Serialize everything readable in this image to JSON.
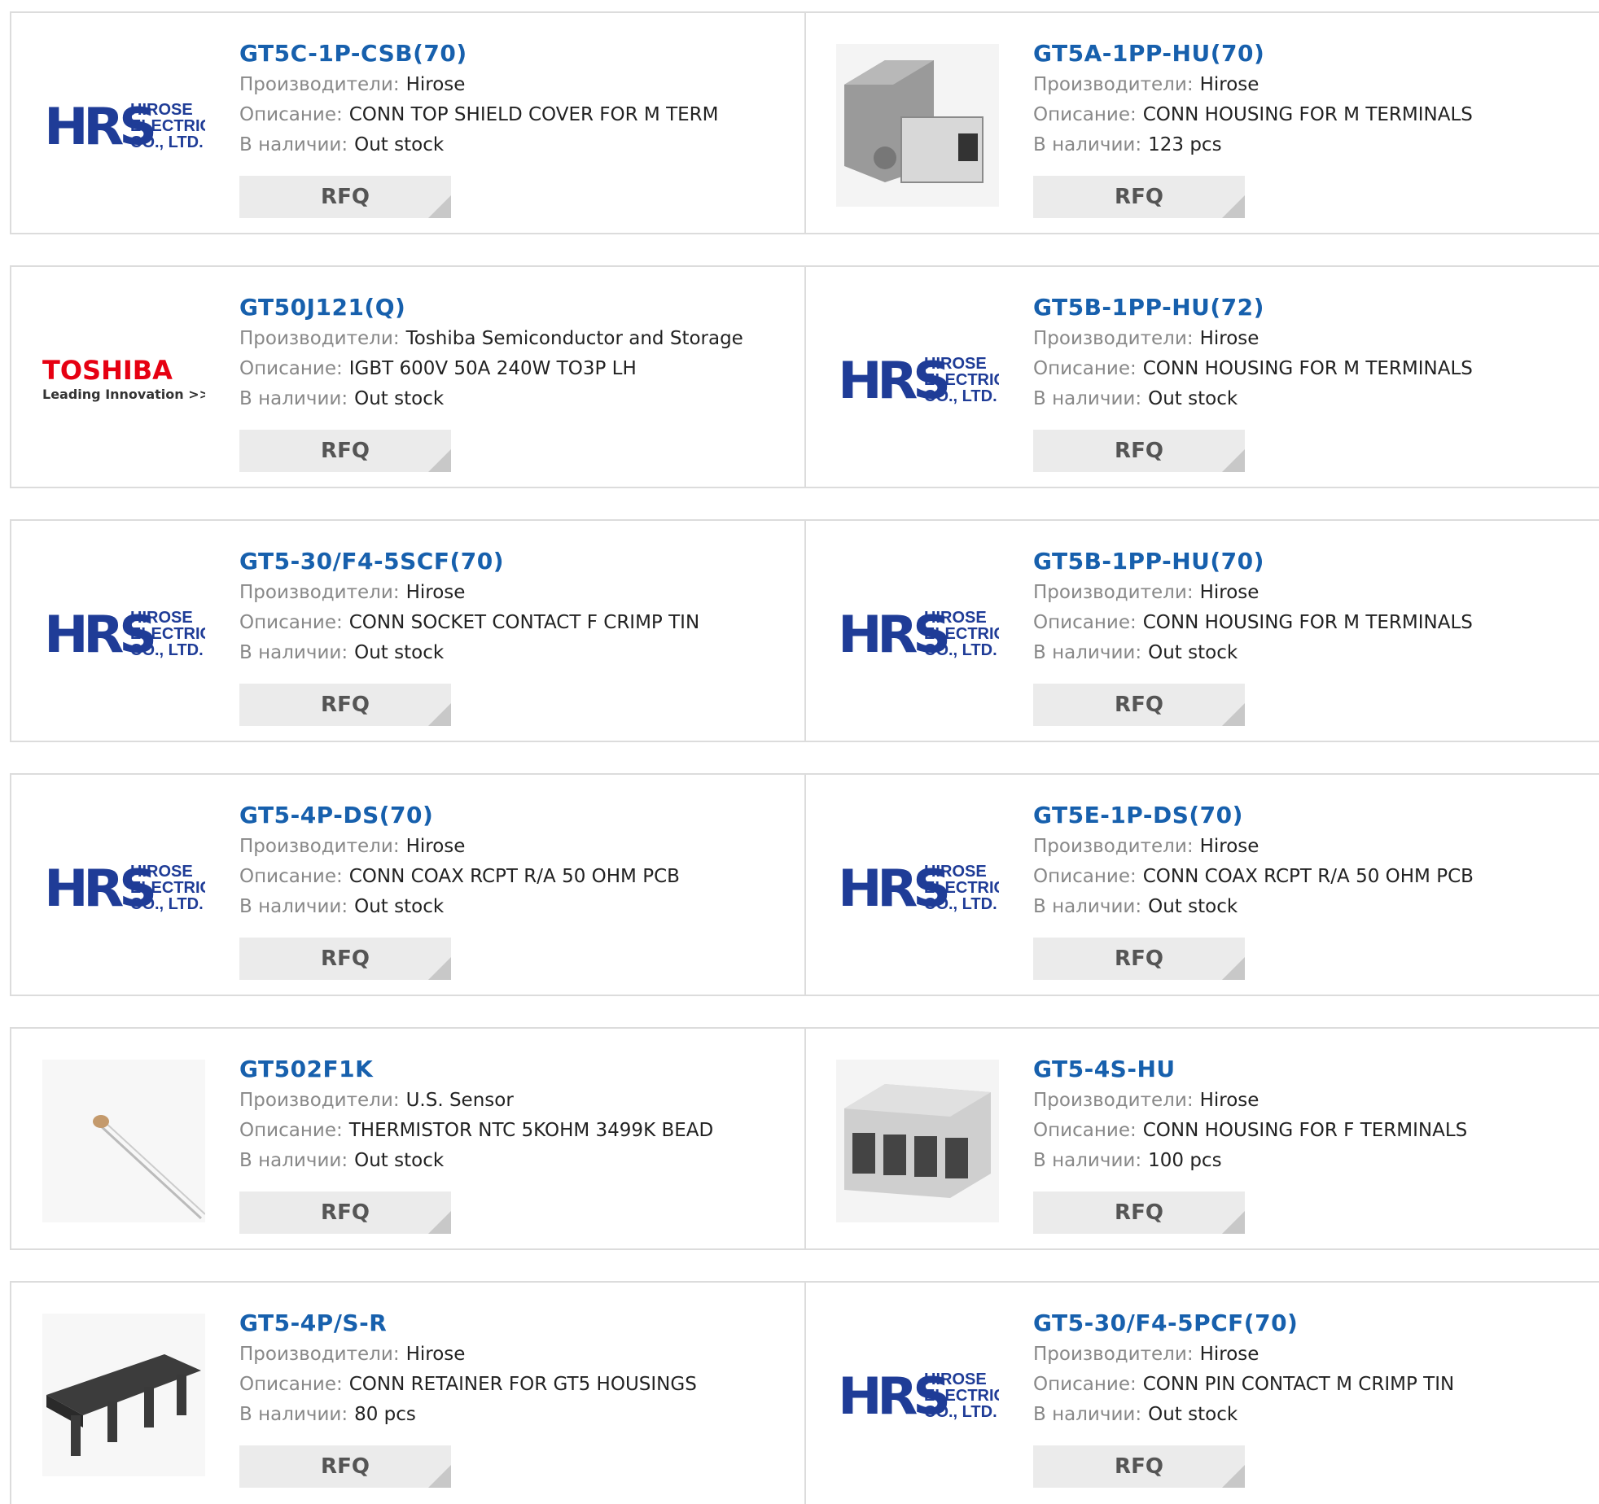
{
  "labels": {
    "manufacturer": "Производители:",
    "description": "Описание:",
    "stock": "В наличии:",
    "rfq": "RFQ"
  },
  "logos": {
    "hrs_mark": "HRS",
    "hrs_text1": "HIROSE",
    "hrs_text2": "ELECTRIC",
    "hrs_text3": "CO., LTD.",
    "toshiba_mark": "TOSHIBA",
    "toshiba_tagline": "Leading Innovation >>>"
  },
  "colors": {
    "link": "#1760ad",
    "hrs_blue": "#1f3c97",
    "toshiba_red": "#e60012"
  },
  "products": [
    {
      "pn": "GT5C-1P-CSB(70)",
      "mfr": "Hirose",
      "desc": "CONN TOP SHIELD COVER FOR M TERM",
      "stock": "Out stock",
      "image": "hrs-logo"
    },
    {
      "pn": "GT5A-1PP-HU(70)",
      "mfr": "Hirose",
      "desc": "CONN HOUSING FOR M TERMINALS",
      "stock": "123 pcs",
      "image": "housing-photo"
    },
    {
      "pn": "GT50J121(Q)",
      "mfr": "Toshiba Semiconductor and Storage",
      "desc": "IGBT 600V 50A 240W TO3P LH",
      "stock": "Out stock",
      "image": "toshiba-logo"
    },
    {
      "pn": "GT5B-1PP-HU(72)",
      "mfr": "Hirose",
      "desc": "CONN HOUSING FOR M TERMINALS",
      "stock": "Out stock",
      "image": "hrs-logo"
    },
    {
      "pn": "GT5-30/F4-5SCF(70)",
      "mfr": "Hirose",
      "desc": "CONN SOCKET CONTACT F CRIMP TIN",
      "stock": "Out stock",
      "image": "hrs-logo"
    },
    {
      "pn": "GT5B-1PP-HU(70)",
      "mfr": "Hirose",
      "desc": "CONN HOUSING FOR M TERMINALS",
      "stock": "Out stock",
      "image": "hrs-logo"
    },
    {
      "pn": "GT5-4P-DS(70)",
      "mfr": "Hirose",
      "desc": "CONN COAX RCPT R/A 50 OHM PCB",
      "stock": "Out stock",
      "image": "hrs-logo"
    },
    {
      "pn": "GT5E-1P-DS(70)",
      "mfr": "Hirose",
      "desc": "CONN COAX RCPT R/A 50 OHM PCB",
      "stock": "Out stock",
      "image": "hrs-logo"
    },
    {
      "pn": "GT502F1K",
      "mfr": "U.S. Sensor",
      "desc": "THERMISTOR NTC 5KOHM 3499K BEAD",
      "stock": "Out stock",
      "image": "thermistor-photo"
    },
    {
      "pn": "GT5-4S-HU",
      "mfr": "Hirose",
      "desc": "CONN HOUSING FOR F TERMINALS",
      "stock": "100 pcs",
      "image": "connector-photo"
    },
    {
      "pn": "GT5-4P/S-R",
      "mfr": "Hirose",
      "desc": "CONN RETAINER FOR GT5 HOUSINGS",
      "stock": "80 pcs",
      "image": "retainer-photo"
    },
    {
      "pn": "GT5-30/F4-5PCF(70)",
      "mfr": "Hirose",
      "desc": "CONN PIN CONTACT M CRIMP TIN",
      "stock": "Out stock",
      "image": "hrs-logo"
    }
  ]
}
